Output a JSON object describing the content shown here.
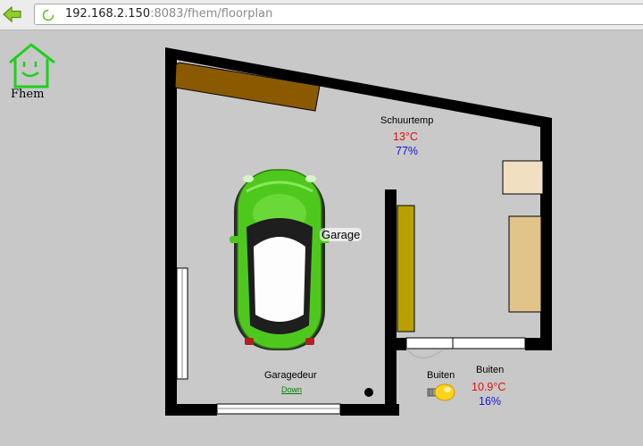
{
  "browser": {
    "url_host": "192.168.2.150",
    "url_rest": ":8083/fhem/floorplan"
  },
  "logo": {
    "label": "Fhem"
  },
  "floorplan": {
    "schuur": {
      "label": "Schuurtemp",
      "temperature": "13°C",
      "humidity": "77%"
    },
    "garage": {
      "label": "Garage"
    },
    "garagedeur": {
      "label": "Garagedeur",
      "state": "Down"
    },
    "buiten_light": {
      "label": "Buiten"
    },
    "buiten_sensor": {
      "label": "Buiten",
      "temperature": "10.9°C",
      "humidity": "16%"
    }
  },
  "colors": {
    "temperature": "#e01010",
    "humidity": "#1515d8",
    "car": "#4fc81e",
    "link": "#008000"
  }
}
